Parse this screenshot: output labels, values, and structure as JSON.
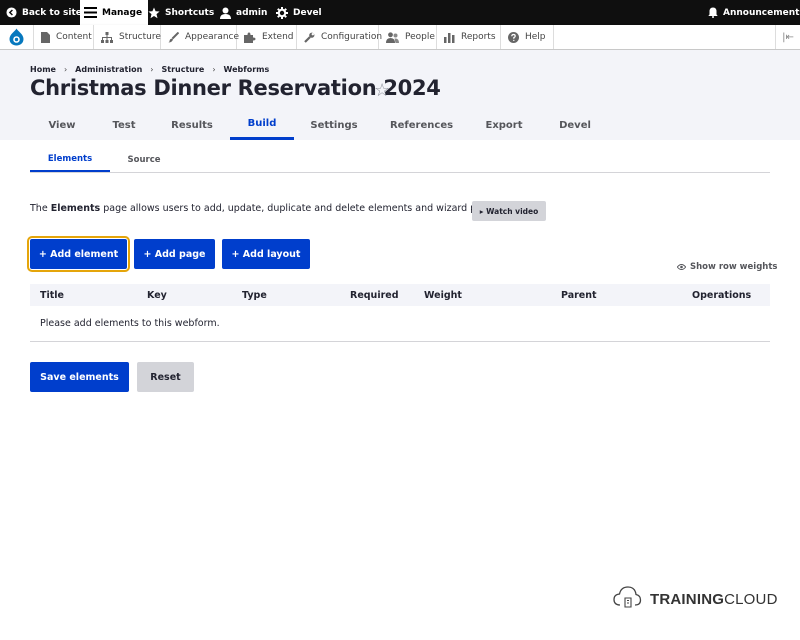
{
  "toolbar": {
    "back_to_site": "Back to site",
    "manage": "Manage",
    "shortcuts": "Shortcuts",
    "user": "admin",
    "devel": "Devel",
    "announcements": "Announcements"
  },
  "tray": {
    "items": [
      {
        "label": "Content",
        "icon": "file-icon"
      },
      {
        "label": "Structure",
        "icon": "sitemap-icon"
      },
      {
        "label": "Appearance",
        "icon": "paintbrush-icon"
      },
      {
        "label": "Extend",
        "icon": "puzzle-icon"
      },
      {
        "label": "Configuration",
        "icon": "wrench-icon"
      },
      {
        "label": "People",
        "icon": "people-icon"
      },
      {
        "label": "Reports",
        "icon": "bar-chart-icon"
      },
      {
        "label": "Help",
        "icon": "help-icon"
      }
    ]
  },
  "breadcrumb": [
    "Home",
    "Administration",
    "Structure",
    "Webforms"
  ],
  "page": {
    "title": "Christmas Dinner Reservation 2024"
  },
  "primary_tabs": [
    "View",
    "Test",
    "Results",
    "Build",
    "Settings",
    "References",
    "Export",
    "Devel"
  ],
  "secondary_tabs": [
    "Elements",
    "Source"
  ],
  "description": {
    "prefix": "The ",
    "bold": "Elements",
    "suffix": " page allows users to add, update, duplicate and delete elements and wizard pages.",
    "watch_video": "▸ Watch video"
  },
  "actions": {
    "add_element": "+ Add element",
    "add_page": "+ Add page",
    "add_layout": "+ Add layout"
  },
  "show_row_weights": "Show row weights",
  "table": {
    "headers": [
      "Title",
      "Key",
      "Type",
      "Required",
      "Weight",
      "Parent",
      "Operations"
    ],
    "empty_message": "Please add elements to this webform."
  },
  "form_actions": {
    "save": "Save elements",
    "reset": "Reset"
  },
  "branding": {
    "bold": "TRAINING",
    "rest": "CLOUD"
  },
  "colors": {
    "primary": "#003ecc",
    "toolbar_bg": "#0f0f0f",
    "focus_outline": "#e5a50a"
  }
}
